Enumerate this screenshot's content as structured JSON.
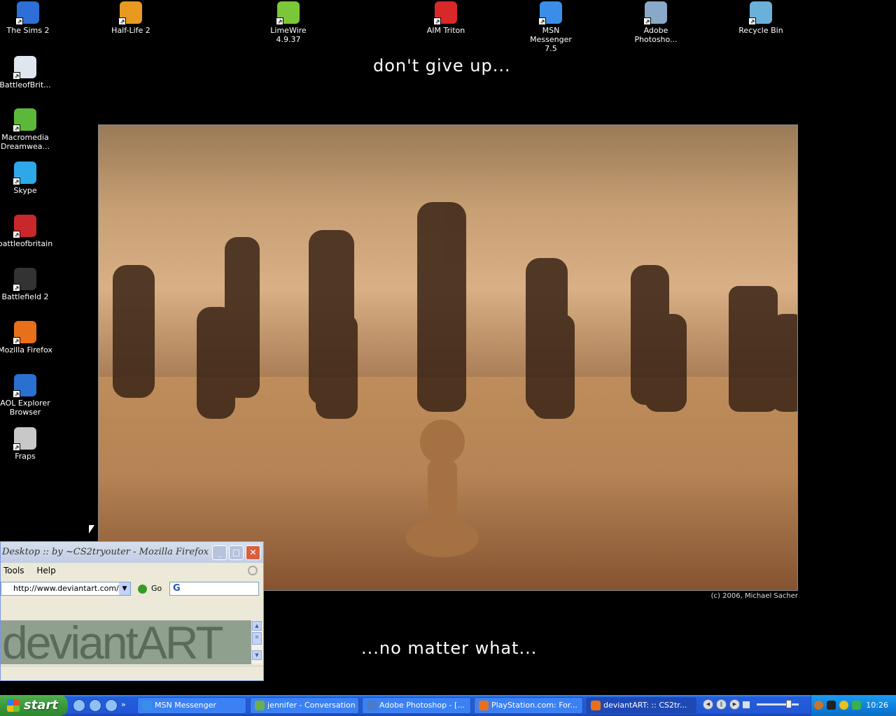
{
  "desktop": {
    "wall_text_top": "don't give up...",
    "wall_text_bottom": "...no matter what...",
    "photo_credit": "(c) 2006, Michael Sacher",
    "icons_top": [
      {
        "label": "The Sims 2",
        "icon": "sims-icon",
        "color": "#2d6fd6"
      },
      {
        "label": "Half-Life 2",
        "icon": "half-life-icon",
        "color": "#e89a20"
      },
      {
        "label": "LimeWire 4.9.37",
        "icon": "limewire-icon",
        "color": "#7ac83a"
      },
      {
        "label": "AIM Triton",
        "icon": "aim-icon",
        "color": "#d8282a"
      },
      {
        "label": "MSN Messenger 7.5",
        "icon": "msn-icon",
        "color": "#3a8ee8"
      },
      {
        "label": "Adobe Photosho...",
        "icon": "photoshop-icon",
        "color": "#8aa8c8"
      },
      {
        "label": "Recycle Bin",
        "icon": "recycle-bin-icon",
        "color": "#6bb0d8"
      }
    ],
    "icons_left": [
      {
        "label": "BattleofBrit...",
        "icon": "window-app-icon",
        "color": "#e0e6f0"
      },
      {
        "label": "Macromedia Dreamwea...",
        "icon": "dreamweaver-icon",
        "color": "#5cb83a"
      },
      {
        "label": "Skype",
        "icon": "skype-icon",
        "color": "#2fa8e8"
      },
      {
        "label": "battleofbritain",
        "icon": "battleofbritain-icon",
        "color": "#c8282a"
      },
      {
        "label": "Battlefield 2",
        "icon": "battlefield-icon",
        "color": "#333333"
      },
      {
        "label": "Mozilla Firefox",
        "icon": "firefox-icon",
        "color": "#e8701a"
      },
      {
        "label": "AOL Explorer Browser",
        "icon": "aol-explorer-icon",
        "color": "#2a70d0"
      },
      {
        "label": "Fraps",
        "icon": "fraps-icon",
        "color": "#c8c8c8"
      }
    ]
  },
  "firefox": {
    "title": "Desktop :: by ~CS2tryouter - Mozilla Firefox",
    "menu": [
      "Tools",
      "Help"
    ],
    "url": "http://www.deviantart.com/vie",
    "go_label": "Go",
    "search_value": "G",
    "content_logo": "deviantART"
  },
  "taskbar": {
    "start_label": "start",
    "tasks": [
      {
        "label": "MSN Messenger",
        "color": "#3a8ee8"
      },
      {
        "label": "jennifer - Conversation",
        "color": "#6bb04a"
      },
      {
        "label": "Adobe Photoshop - [...",
        "color": "#4a7ac8"
      },
      {
        "label": "PlayStation.com: For...",
        "color": "#e8701a"
      },
      {
        "label": "deviantART: :: CS2tr...",
        "color": "#e8701a"
      }
    ],
    "clock": "10:26"
  }
}
